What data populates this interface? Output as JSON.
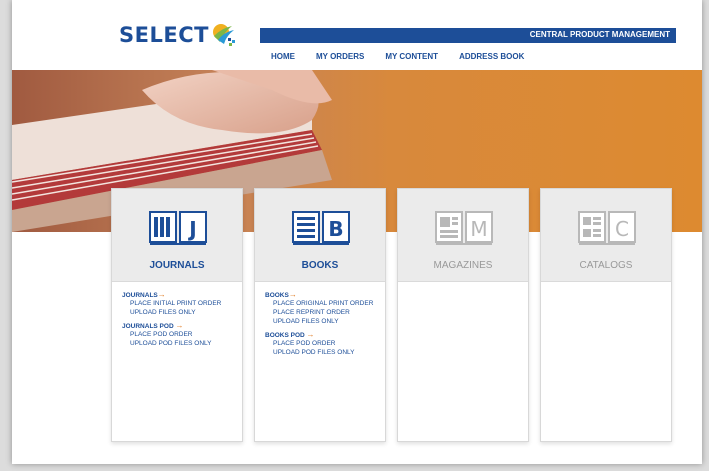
{
  "brand": {
    "logo_text": "SELECT",
    "bar_label": "CENTRAL PRODUCT MANAGEMENT",
    "primary_color": "#1d4e98",
    "accent_color": "#e07b22"
  },
  "nav": [
    "HOME",
    "MY ORDERS",
    "MY CONTENT",
    "ADDRESS BOOK"
  ],
  "cards": [
    {
      "letter": "J",
      "title": "JOURNALS",
      "active": true,
      "groups": [
        {
          "label": "JOURNALS",
          "arrow": "→",
          "links": [
            "PLACE INITIAL PRINT ORDER",
            "UPLOAD FILES ONLY"
          ]
        },
        {
          "label": "JOURNALS POD",
          "arrow": "→",
          "links": [
            "PLACE POD ORDER",
            "UPLOAD POD FILES ONLY"
          ]
        }
      ]
    },
    {
      "letter": "B",
      "title": "BOOKS",
      "active": true,
      "groups": [
        {
          "label": "BOOKS",
          "arrow": "→",
          "links": [
            "PLACE ORIGINAL PRINT ORDER",
            "PLACE REPRINT ORDER",
            "UPLOAD FILES ONLY"
          ]
        },
        {
          "label": "BOOKS POD",
          "arrow": "→",
          "links": [
            "PLACE POD ORDER",
            "UPLOAD POD FILES ONLY"
          ]
        }
      ]
    },
    {
      "letter": "M",
      "title": "MAGAZINES",
      "active": false,
      "groups": []
    },
    {
      "letter": "C",
      "title": "CATALOGS",
      "active": false,
      "groups": []
    }
  ]
}
